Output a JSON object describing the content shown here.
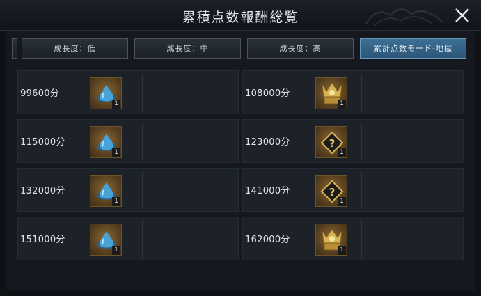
{
  "header": {
    "title": "累積点数報酬総覧",
    "close_icon": "close-icon"
  },
  "tabs": [
    {
      "label": "成長度：低",
      "active": false
    },
    {
      "label": "成長度：中",
      "active": false
    },
    {
      "label": "成長度：高",
      "active": false
    },
    {
      "label": "累計点数モード-地獄",
      "active": true
    }
  ],
  "rewards": {
    "left": [
      {
        "score": "99600分",
        "icon": "water-drop-icon",
        "qty": "1"
      },
      {
        "score": "115000分",
        "icon": "water-drop-icon",
        "qty": "1"
      },
      {
        "score": "132000分",
        "icon": "water-drop-icon",
        "qty": "1"
      },
      {
        "score": "151000分",
        "icon": "water-drop-icon",
        "qty": "1"
      }
    ],
    "right": [
      {
        "score": "108000分",
        "icon": "golden-helmet-icon",
        "qty": "1"
      },
      {
        "score": "123000分",
        "icon": "mystery-box-icon",
        "qty": "1"
      },
      {
        "score": "141000分",
        "icon": "mystery-box-icon",
        "qty": "1"
      },
      {
        "score": "162000分",
        "icon": "golden-helmet-icon",
        "qty": "1"
      }
    ]
  },
  "colors": {
    "accent_tab": "#3d6f95",
    "item_frame": "#6d5428",
    "panel_bg": "#15191f"
  }
}
